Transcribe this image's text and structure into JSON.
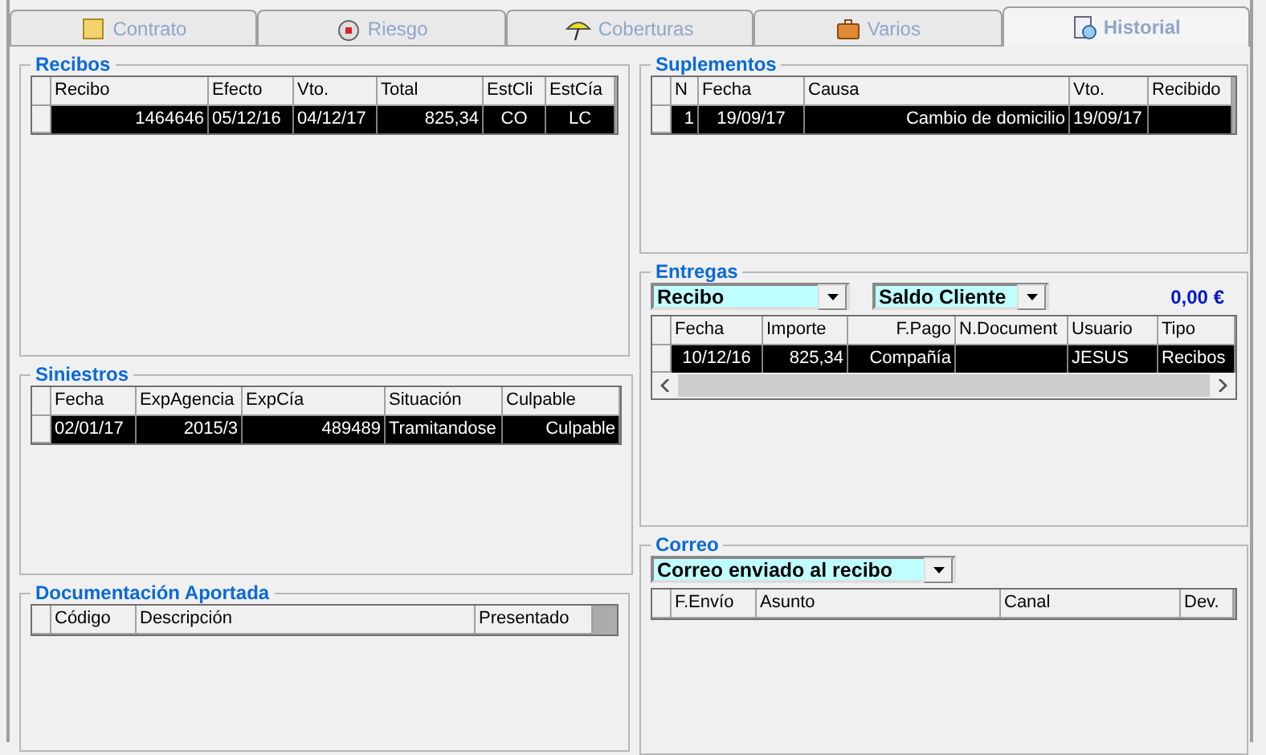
{
  "tabs": [
    {
      "label": "Contrato",
      "selected": false
    },
    {
      "label": "Riesgo",
      "selected": false
    },
    {
      "label": "Coberturas",
      "selected": false
    },
    {
      "label": "Varios",
      "selected": false
    },
    {
      "label": "Historial",
      "selected": true
    }
  ],
  "recibos": {
    "title": "Recibos",
    "columns": [
      "Recibo",
      "Efecto",
      "Vto.",
      "Total",
      "EstCli",
      "EstCía"
    ],
    "rows": [
      {
        "cells": [
          "1464646",
          "05/12/16",
          "04/12/17",
          "825,34",
          "CO",
          "LC"
        ],
        "selected": true
      }
    ]
  },
  "siniestros": {
    "title": "Siniestros",
    "columns": [
      "Fecha",
      "ExpAgencia",
      "ExpCía",
      "Situación",
      "Culpable"
    ],
    "rows": [
      {
        "cells": [
          "02/01/17",
          "2015/3",
          "489489",
          "Tramitandose",
          "Culpable"
        ],
        "selected": true
      }
    ]
  },
  "documentacion": {
    "title": "Documentación Aportada",
    "columns": [
      "Código",
      "Descripción",
      "Presentado"
    ]
  },
  "suplementos": {
    "title": "Suplementos",
    "columns": [
      "N",
      "Fecha",
      "Causa",
      "Vto.",
      "Recibido"
    ],
    "rows": [
      {
        "cells": [
          "1",
          "19/09/17",
          "Cambio de domicilio",
          "19/09/17",
          ""
        ],
        "selected": true
      }
    ]
  },
  "entregas": {
    "title": "Entregas",
    "type_select": "Recibo",
    "saldo_select": "Saldo Cliente",
    "saldo": "0,00 €",
    "columns": [
      "Fecha",
      "Importe",
      "F.Pago",
      "N.Document",
      "Usuario",
      "Tipo"
    ],
    "rows": [
      {
        "cells": [
          "10/12/16",
          "825,34",
          "Compañía",
          "",
          "JESUS",
          "Recibos"
        ],
        "selected": true
      }
    ]
  },
  "correo": {
    "title": "Correo",
    "select": "Correo enviado al recibo",
    "columns": [
      "F.Envío",
      "Asunto",
      "Canal",
      "Dev."
    ]
  }
}
